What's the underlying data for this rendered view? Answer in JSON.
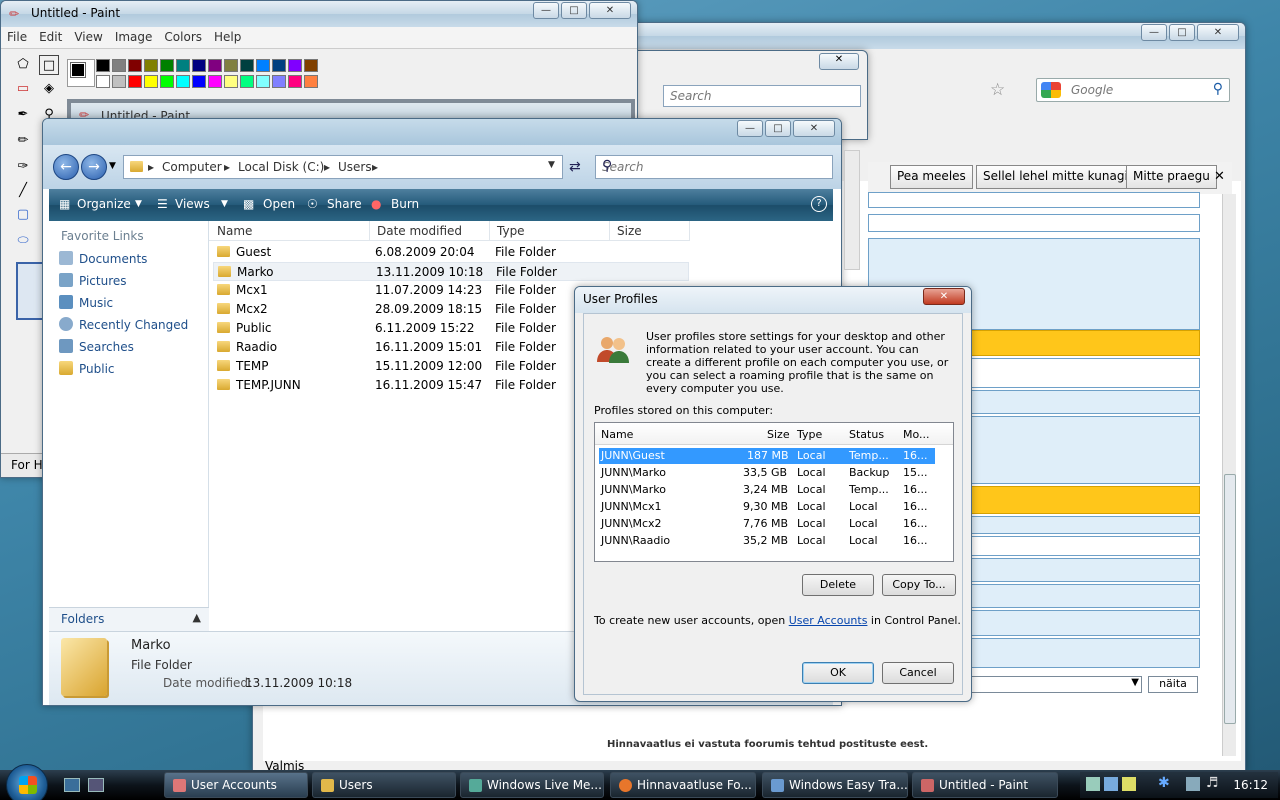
{
  "browser": {
    "search_placeholder": "Google",
    "infobar": {
      "remember": "Pea meeles",
      "never": "Sellel lehel mitte kunagi",
      "not_now": "Mitte praegu"
    },
    "show_button": "näita",
    "footer_text": "Hinnavaatlus ei vastuta foorumis tehtud postituste eest.",
    "status": "Valmis",
    "small_search_placeholder": "Search"
  },
  "paint": {
    "title": "Untitled - Paint",
    "menu": [
      "File",
      "Edit",
      "View",
      "Image",
      "Colors",
      "Help"
    ],
    "inner_title": "Untitled - Paint",
    "status_text": "For He",
    "palette_colors": [
      "#000000",
      "#808080",
      "#800000",
      "#808000",
      "#008000",
      "#008080",
      "#000080",
      "#800080",
      "#808040",
      "#004040",
      "#0080ff",
      "#004080",
      "#8000ff",
      "#804000",
      "#ffffff",
      "#c0c0c0",
      "#ff0000",
      "#ffff00",
      "#00ff00",
      "#00ffff",
      "#0000ff",
      "#ff00ff",
      "#ffff80",
      "#00ff80",
      "#80ffff",
      "#8080ff",
      "#ff0080",
      "#ff8040"
    ]
  },
  "explorer": {
    "breadcrumb": [
      "Computer",
      "Local Disk (C:)",
      "Users"
    ],
    "search_placeholder": "Search",
    "commands": {
      "organize": "Organize",
      "views": "Views",
      "open": "Open",
      "share": "Share",
      "burn": "Burn"
    },
    "favorite_links_header": "Favorite Links",
    "favorites": [
      "Documents",
      "Pictures",
      "Music",
      "Recently Changed",
      "Searches",
      "Public"
    ],
    "folders_label": "Folders",
    "columns": {
      "name": "Name",
      "date": "Date modified",
      "type": "Type",
      "size": "Size"
    },
    "rows": [
      {
        "name": "Guest",
        "date": "6.08.2009 20:04",
        "type": "File Folder"
      },
      {
        "name": "Marko",
        "date": "13.11.2009 10:18",
        "type": "File Folder"
      },
      {
        "name": "Mcx1",
        "date": "11.07.2009 14:23",
        "type": "File Folder"
      },
      {
        "name": "Mcx2",
        "date": "28.09.2009 18:15",
        "type": "File Folder"
      },
      {
        "name": "Public",
        "date": "6.11.2009 15:22",
        "type": "File Folder"
      },
      {
        "name": "Raadio",
        "date": "16.11.2009 15:01",
        "type": "File Folder"
      },
      {
        "name": "TEMP",
        "date": "15.11.2009 12:00",
        "type": "File Folder"
      },
      {
        "name": "TEMP.JUNN",
        "date": "16.11.2009 15:47",
        "type": "File Folder"
      }
    ],
    "details": {
      "name": "Marko",
      "kind": "File Folder",
      "date_label": "Date modified:",
      "date_value": "13.11.2009 10:18"
    }
  },
  "dialog": {
    "title": "User Profiles",
    "description": "User profiles store settings for your desktop and other information related to your user account. You can create a different profile on each computer you use, or you can select a roaming profile that is the same on every computer you use.",
    "stored_label": "Profiles stored on this computer:",
    "columns": {
      "name": "Name",
      "size": "Size",
      "type": "Type",
      "status": "Status",
      "modified": "Mo..."
    },
    "profiles": [
      {
        "name": "JUNN\\Guest",
        "size": "187 MB",
        "type": "Local",
        "status": "Temp...",
        "modified": "16..."
      },
      {
        "name": "JUNN\\Marko",
        "size": "33,5 GB",
        "type": "Local",
        "status": "Backup",
        "modified": "15..."
      },
      {
        "name": "JUNN\\Marko",
        "size": "3,24 MB",
        "type": "Local",
        "status": "Temp...",
        "modified": "16..."
      },
      {
        "name": "JUNN\\Mcx1",
        "size": "9,30 MB",
        "type": "Local",
        "status": "Local",
        "modified": "16..."
      },
      {
        "name": "JUNN\\Mcx2",
        "size": "7,76 MB",
        "type": "Local",
        "status": "Local",
        "modified": "16..."
      },
      {
        "name": "JUNN\\Raadio",
        "size": "35,2 MB",
        "type": "Local",
        "status": "Local",
        "modified": "16..."
      }
    ],
    "delete_label": "Delete",
    "copy_label": "Copy To...",
    "footer_prefix": "To create new user accounts, open ",
    "footer_link": "User Accounts",
    "footer_suffix": " in Control Panel.",
    "ok_label": "OK",
    "cancel_label": "Cancel"
  },
  "taskbar": {
    "tasks": [
      "User Accounts",
      "Users",
      "Windows Live Me...",
      "Hinnavaatluse Fo...",
      "Windows Easy Tra...",
      "Untitled - Paint"
    ],
    "clock": "16:12"
  }
}
